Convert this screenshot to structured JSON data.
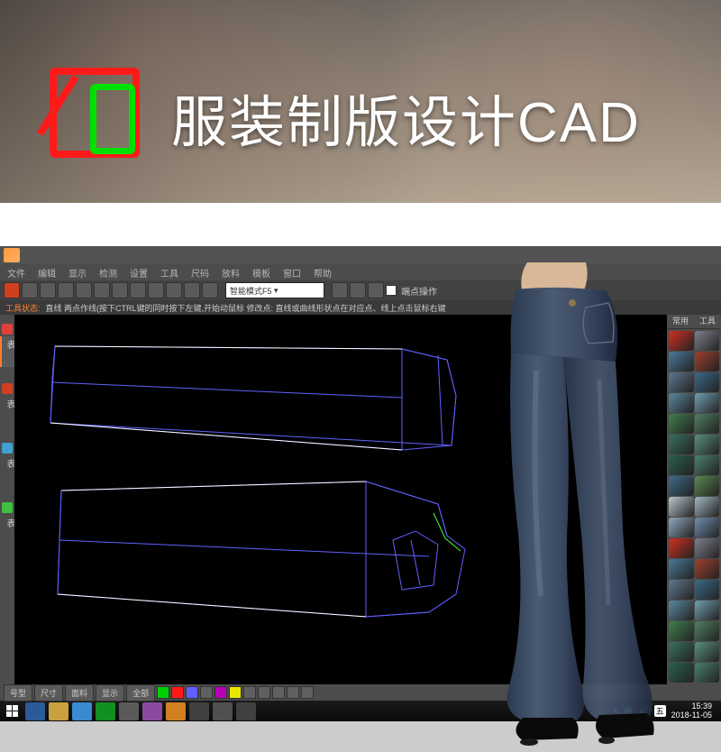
{
  "hero": {
    "title": "服装制版设计CAD"
  },
  "app": {
    "menubar": [
      "文件",
      "编辑",
      "显示",
      "检测",
      "设置",
      "工具",
      "尺码",
      "放料",
      "模板",
      "窗口",
      "帮助"
    ],
    "toolbar": {
      "dropdown_value": "智能模式F5",
      "checkbox_label": "端点操作"
    },
    "status": {
      "label": "工具状态:",
      "text": "直线 两点作线(按下CTRL键的同时按下左键,开始动鼠标  修改点: 直线或曲线形状点在对应点、线上点击鼠标右键"
    },
    "left_tabs": [
      "规格表",
      "物料表",
      "纸样表",
      "工序表"
    ],
    "right_header": [
      "常用",
      "工具"
    ],
    "bottom_tabs": [
      "号型",
      "尺寸",
      "面料",
      "显示",
      "全部"
    ]
  },
  "taskbar": {
    "time": "15:39",
    "date": "2018-11-05"
  },
  "colors": {
    "tool_palette": [
      "#d03020",
      "#808090",
      "#4a7a9a",
      "#a04030",
      "#607890",
      "#3a6a8a",
      "#5a88a0",
      "#70a0b0",
      "#408050",
      "#508060",
      "#3a7060",
      "#5a9080",
      "#2a6050",
      "#4a8070",
      "#406a8a",
      "#5a8a50",
      "#b8c8d0",
      "#a4b8c4",
      "#90a8c0",
      "#7090b0"
    ]
  }
}
